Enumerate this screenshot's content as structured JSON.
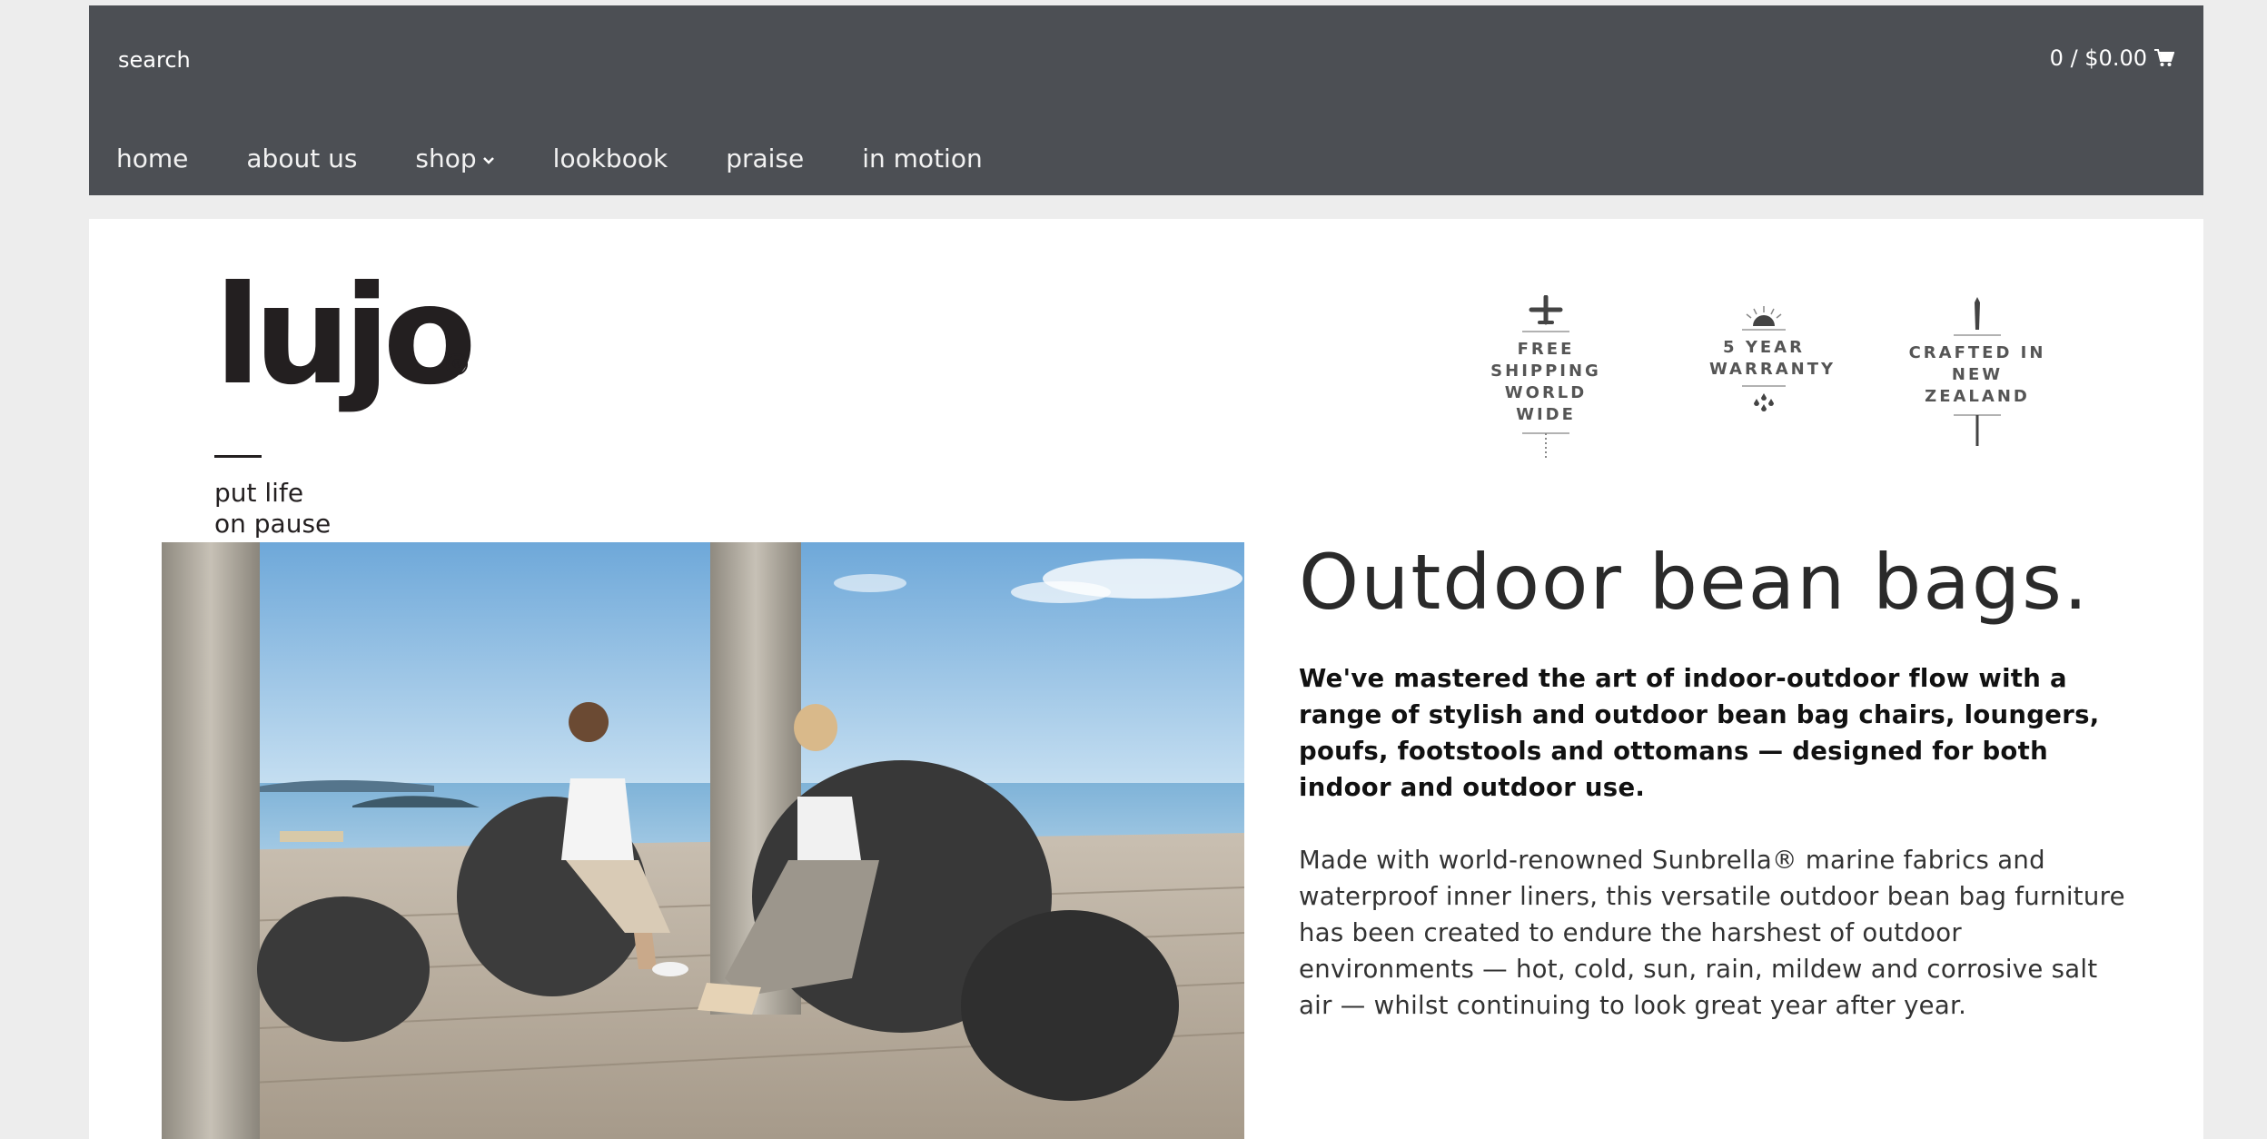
{
  "header": {
    "search_label": "search",
    "cart_label": "0 / $0.00",
    "cart_icon": "cart-icon",
    "nav": [
      {
        "label": "home"
      },
      {
        "label": "about us"
      },
      {
        "label": "shop",
        "has_dropdown": true
      },
      {
        "label": "lookbook"
      },
      {
        "label": "praise"
      },
      {
        "label": "in motion"
      }
    ]
  },
  "brand": {
    "logo_text": "lujo",
    "registered": "®",
    "tagline_line1": "put life",
    "tagline_line2": "on pause"
  },
  "badges": [
    {
      "icon": "airplane-icon",
      "line1": "FREE SHIPPING",
      "line2": "WORLD WIDE"
    },
    {
      "icon": "sun-icon",
      "line1": "5 YEAR",
      "line2": "WARRANTY"
    },
    {
      "icon": "needle-icon",
      "line1": "CRAFTED IN",
      "line2": "NEW ZEALAND"
    }
  ],
  "content": {
    "title": "Outdoor bean bags.",
    "lead": "We've mastered the art of indoor-outdoor flow with a range of stylish and outdoor bean bag chairs, loungers, poufs, footstools and ottomans — designed for both indoor and outdoor use.",
    "body": "Made with world-renowned Sunbrella® marine fabrics and waterproof inner liners, this versatile outdoor bean bag furniture has been created to endure the harshest of outdoor environments — hot, cold, sun, rain, mildew and corrosive salt air — whilst continuing to look great year after year."
  },
  "colors": {
    "header_bg": "#4c4f54",
    "page_bg": "#ededed",
    "panel_bg": "#ffffff",
    "text_dark": "#2a2a2a"
  }
}
